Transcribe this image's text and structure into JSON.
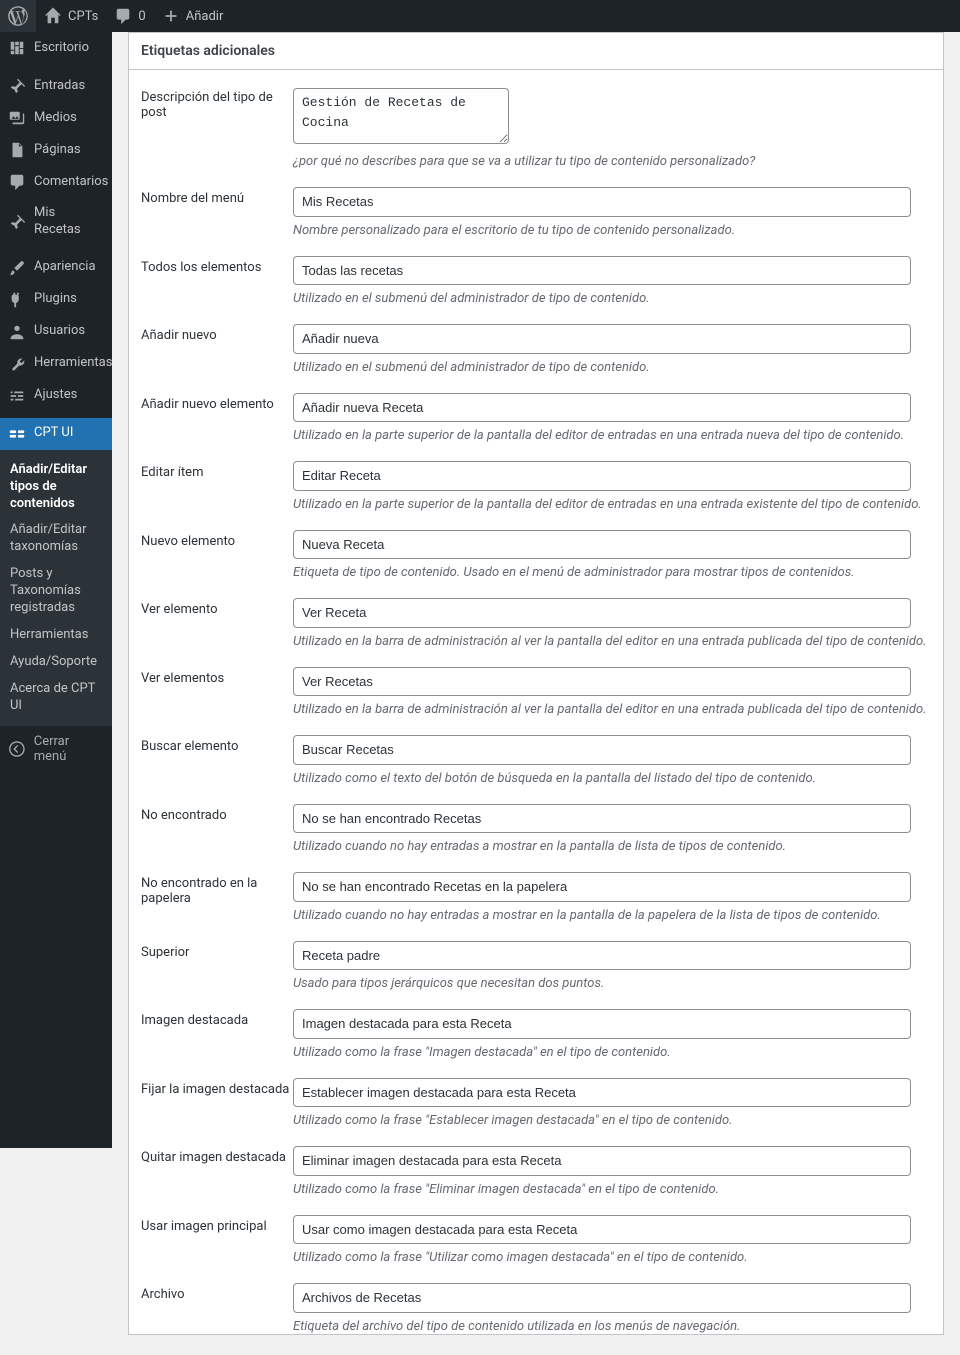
{
  "adminbar": {
    "site_name": "CPTs",
    "comments_count": "0",
    "new_label": "Añadir"
  },
  "sidebar": {
    "items": [
      {
        "id": "dashboard",
        "label": "Escritorio",
        "icon": "dashboard"
      },
      {
        "id": "posts",
        "label": "Entradas",
        "icon": "pin"
      },
      {
        "id": "media",
        "label": "Medios",
        "icon": "media"
      },
      {
        "id": "pages",
        "label": "Páginas",
        "icon": "page"
      },
      {
        "id": "comments",
        "label": "Comentarios",
        "icon": "comment"
      },
      {
        "id": "recetas",
        "label": "Mis Recetas",
        "icon": "pin"
      },
      {
        "id": "appearance",
        "label": "Apariencia",
        "icon": "brush"
      },
      {
        "id": "plugins",
        "label": "Plugins",
        "icon": "plug"
      },
      {
        "id": "users",
        "label": "Usuarios",
        "icon": "users"
      },
      {
        "id": "tools",
        "label": "Herramientas",
        "icon": "wrench"
      },
      {
        "id": "settings",
        "label": "Ajustes",
        "icon": "sliders"
      },
      {
        "id": "cptui",
        "label": "CPT UI",
        "icon": "cptui",
        "current": true
      }
    ],
    "submenu": [
      {
        "label": "Añadir/Editar tipos de contenidos",
        "current": true
      },
      {
        "label": "Añadir/Editar taxonomías"
      },
      {
        "label": "Posts y Taxonomías registradas"
      },
      {
        "label": "Herramientas"
      },
      {
        "label": "Ayuda/Soporte"
      },
      {
        "label": "Acerca de CPT UI"
      }
    ],
    "collapse_label": "Cerrar menú"
  },
  "panel": {
    "title": "Etiquetas adicionales",
    "fields": [
      {
        "key": "description",
        "label": "Descripción del tipo de post",
        "value": "Gestión de Recetas de Cocina",
        "type": "textarea",
        "desc": "¿por qué no describes para que se va a utilizar tu tipo de contenido personalizado?"
      },
      {
        "key": "menu_name",
        "label": "Nombre del menú",
        "value": "Mis Recetas",
        "desc": "Nombre personalizado para el escritorio de tu tipo de contenido personalizado."
      },
      {
        "key": "all_items",
        "label": "Todos los elementos",
        "value": "Todas las recetas",
        "desc": "Utilizado en el submenú del administrador de tipo de contenido."
      },
      {
        "key": "add_new",
        "label": "Añadir nuevo",
        "value": "Añadir nueva",
        "desc": "Utilizado en el submenú del administrador de tipo de contenido."
      },
      {
        "key": "add_new_item",
        "label": "Añadir nuevo elemento",
        "value": "Añadir nueva Receta",
        "desc": "Utilizado en la parte superior de la pantalla del editor de entradas en una entrada nueva del tipo de contenido."
      },
      {
        "key": "edit_item",
        "label": "Editar ítem",
        "value": "Editar Receta",
        "desc": "Utilizado en la parte superior de la pantalla del editor de entradas en una entrada existente del tipo de contenido."
      },
      {
        "key": "new_item",
        "label": "Nuevo elemento",
        "value": "Nueva Receta",
        "desc": "Etiqueta de tipo de contenido. Usado en el menú de administrador para mostrar tipos de contenidos."
      },
      {
        "key": "view_item",
        "label": "Ver elemento",
        "value": "Ver Receta",
        "desc": "Utilizado en la barra de administración al ver la pantalla del editor en una entrada publicada del tipo de contenido."
      },
      {
        "key": "view_items",
        "label": "Ver elementos",
        "value": "Ver Recetas",
        "desc": "Utilizado en la barra de administración al ver la pantalla del editor en una entrada publicada del tipo de contenido."
      },
      {
        "key": "search_items",
        "label": "Buscar elemento",
        "value": "Buscar Recetas",
        "desc": "Utilizado como el texto del botón de búsqueda en la pantalla del listado del tipo de contenido."
      },
      {
        "key": "not_found",
        "label": "No encontrado",
        "value": "No se han encontrado Recetas",
        "desc": "Utilizado cuando no hay entradas a mostrar en la pantalla de lista de tipos de contenido."
      },
      {
        "key": "not_found_in_trash",
        "label": "No encontrado en la papelera",
        "value": "No se han encontrado Recetas en la papelera",
        "desc": "Utilizado cuando no hay entradas a mostrar en la pantalla de la papelera de la lista de tipos de contenido."
      },
      {
        "key": "parent",
        "label": "Superior",
        "value": "Receta padre",
        "desc": "Usado para tipos jerárquicos que necesitan dos puntos."
      },
      {
        "key": "featured_image",
        "label": "Imagen destacada",
        "value": "Imagen destacada para esta Receta",
        "desc": "Utilizado como la frase \"Imagen destacada\" en el tipo de contenido."
      },
      {
        "key": "set_featured_image",
        "label": "Fijar la imagen destacada",
        "value": "Establecer imagen destacada para esta Receta",
        "desc": "Utilizado como la frase \"Establecer imagen destacada\" en el tipo de contenido."
      },
      {
        "key": "remove_featured_image",
        "label": "Quitar imagen destacada",
        "value": "Eliminar imagen destacada para esta Receta",
        "desc": "Utilizado como la frase \"Eliminar imagen destacada\" en el tipo de contenido."
      },
      {
        "key": "use_featured_image",
        "label": "Usar imagen principal",
        "value": "Usar como imagen destacada para esta Receta",
        "desc": "Utilizado como la frase \"Utilizar como imagen destacada\" en el tipo de contenido."
      },
      {
        "key": "archives",
        "label": "Archivo",
        "value": "Archivos de Recetas",
        "desc": "Etiqueta del archivo del tipo de contenido utilizada en los menús de navegación."
      }
    ]
  }
}
